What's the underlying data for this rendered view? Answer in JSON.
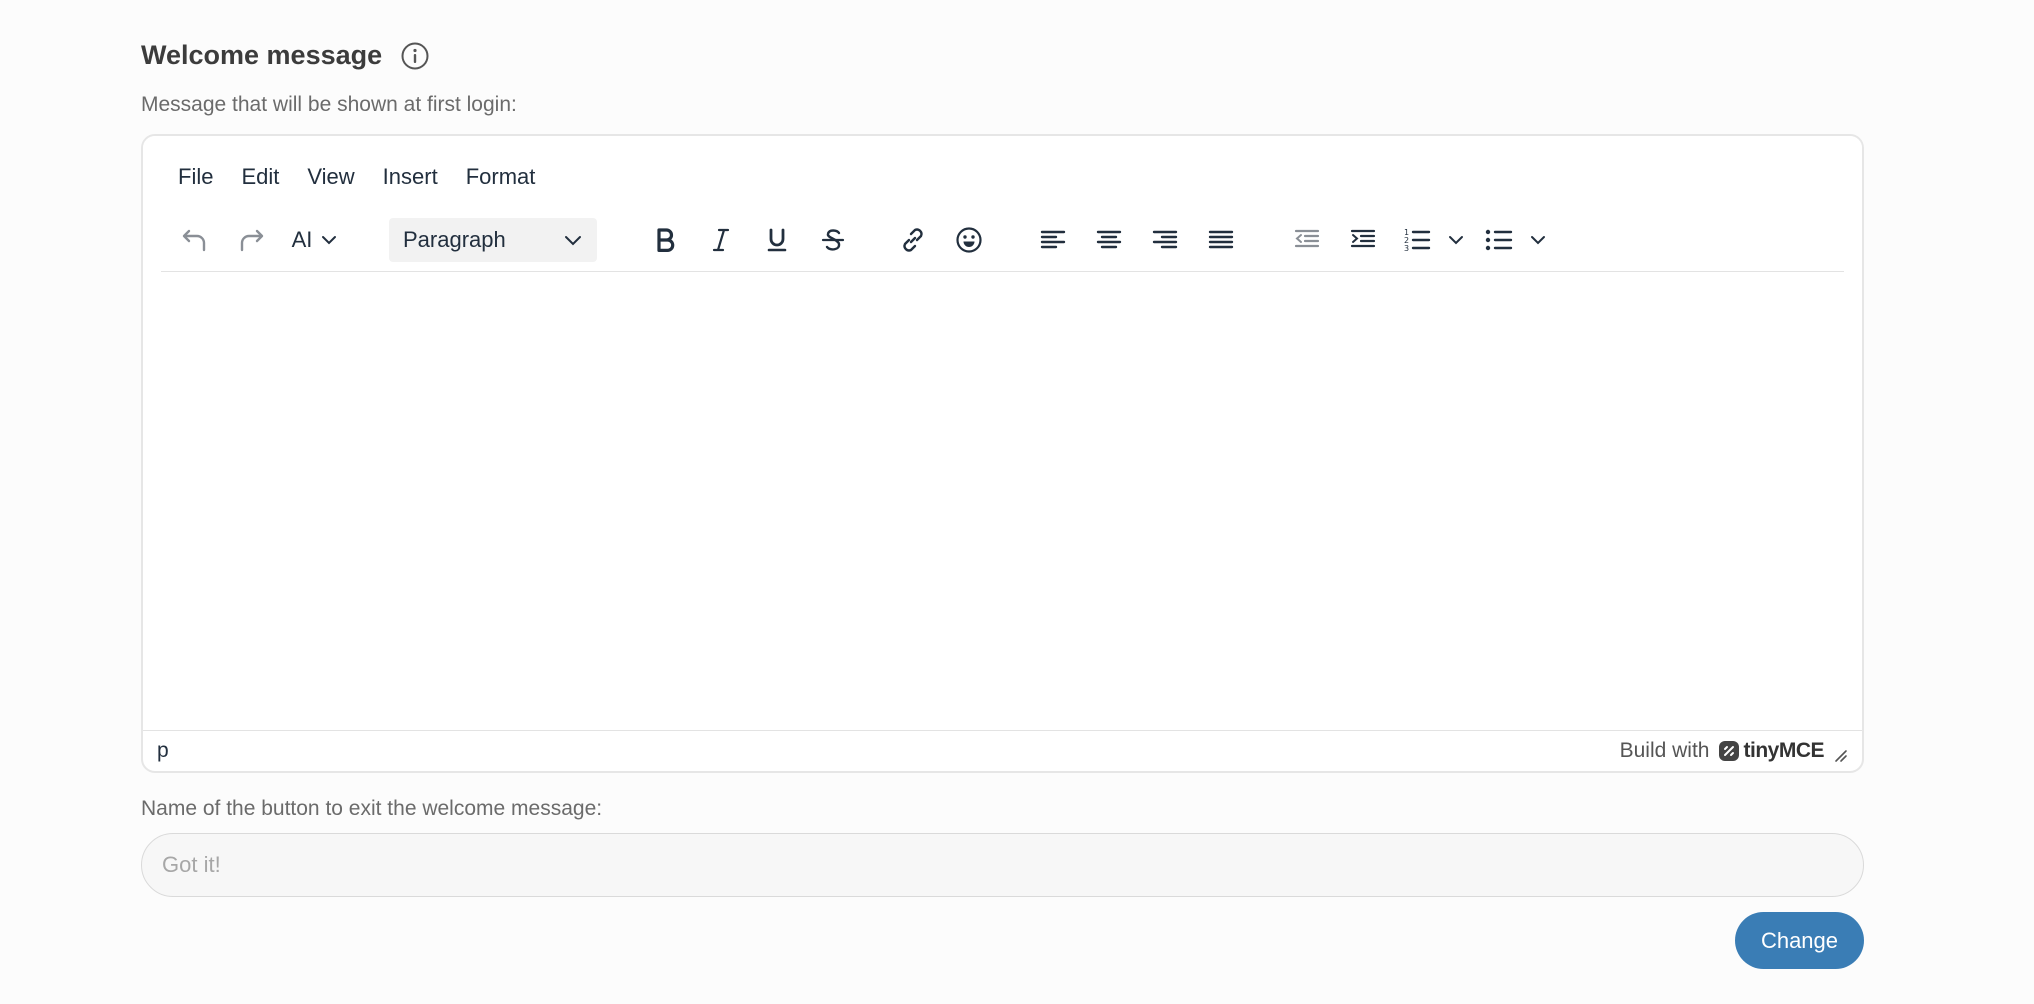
{
  "section": {
    "title": "Welcome message",
    "subtitle": "Message that will be shown at first login:"
  },
  "editor": {
    "menubar": [
      "File",
      "Edit",
      "View",
      "Insert",
      "Format"
    ],
    "toolbar": {
      "ai_label": "AI",
      "block_format": "Paragraph"
    },
    "statusbar": {
      "path": "p",
      "build_with": "Build with",
      "brand": "tinyMCE"
    }
  },
  "button_name": {
    "label": "Name of the button to exit the welcome message:",
    "placeholder": "Got it!",
    "value": ""
  },
  "actions": {
    "change_label": "Change"
  },
  "colors": {
    "primary": "#3a7db5",
    "toolbar_icon": "#222f3e",
    "disabled_icon": "#8a8f96"
  }
}
